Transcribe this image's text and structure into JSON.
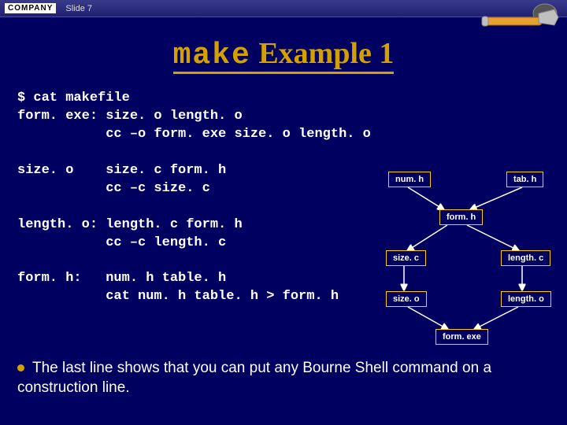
{
  "topbar": {
    "logo": "COMPANY",
    "slide": "Slide 7"
  },
  "title": {
    "word1": "make",
    "word2": "Example 1"
  },
  "code": {
    "l1": "$ cat makefile",
    "l2": "form. exe: size. o length. o",
    "l3": "           cc –o form. exe size. o length. o",
    "l4": "",
    "l5": "size. o    size. c form. h",
    "l6": "           cc –c size. c",
    "l7": "",
    "l8": "length. o: length. c form. h",
    "l9": "           cc –c length. c",
    "l10": "",
    "l11": "form. h:   num. h table. h",
    "l12": "           cat num. h table. h > form. h"
  },
  "nodes": {
    "numh": "num. h",
    "tabh": "tab. h",
    "formh": "form. h",
    "sizec": "size. c",
    "lengthc": "length. c",
    "sizeo": "size. o",
    "lengtho": "length. o",
    "formexe": "form. exe"
  },
  "bullet": {
    "text": "The last line shows that you can put any Bourne Shell command on a construction line."
  }
}
